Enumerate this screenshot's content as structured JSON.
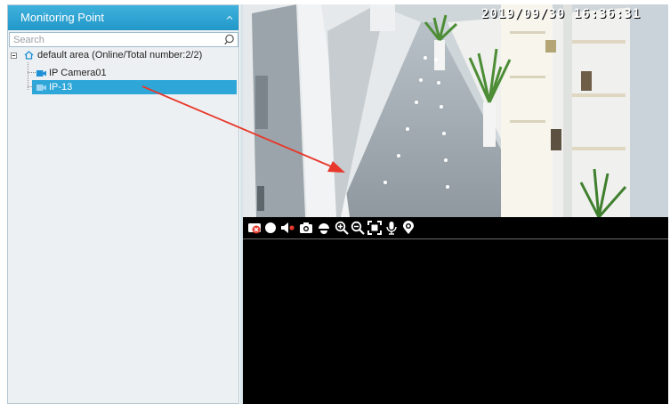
{
  "panel": {
    "title": "Monitoring Point",
    "search_placeholder": "Search"
  },
  "tree": {
    "area_label": "default area (Online/Total number:2/2)",
    "cameras": [
      {
        "label": "IP Camera01",
        "selected": false
      },
      {
        "label": "IP-13",
        "selected": true
      }
    ]
  },
  "video": {
    "timestamp": "2019/09/30  16:36:31"
  },
  "toolbar_icons": [
    "stop-icon",
    "record-icon",
    "audio-mute-icon",
    "snapshot-icon",
    "ptz-icon",
    "zoom-in-icon",
    "zoom-out-icon",
    "fullscreen-icon",
    "microphone-icon",
    "location-icon"
  ],
  "colors": {
    "header": "#2a9fd0",
    "selection": "#2ea6d8",
    "camera_icon": "#1e90d6",
    "arrow": "#e8382b"
  }
}
